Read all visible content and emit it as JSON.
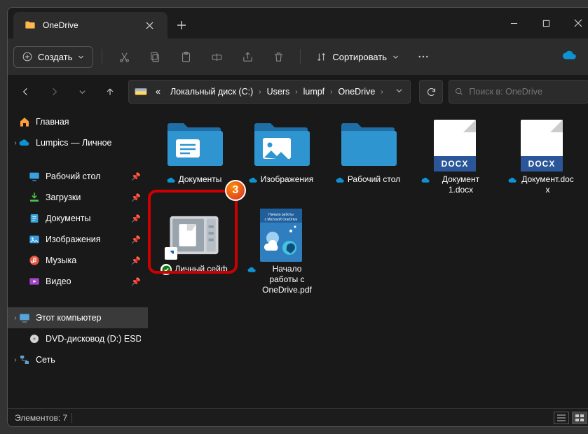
{
  "tab": {
    "title": "OneDrive"
  },
  "toolbar": {
    "new_label": "Создать",
    "sort_label": "Сортировать"
  },
  "breadcrumb": {
    "disk_prefix": "«",
    "segments": [
      "Локальный диск (C:)",
      "Users",
      "lumpf",
      "OneDrive"
    ]
  },
  "search": {
    "placeholder": "Поиск в: OneDrive"
  },
  "sidebar": {
    "home": "Главная",
    "onedrive": "Lumpics — Личное",
    "desktop": "Рабочий стол",
    "downloads": "Загрузки",
    "documents": "Документы",
    "pictures": "Изображения",
    "music": "Музыка",
    "videos": "Видео",
    "this_pc": "Этот компьютер",
    "dvd": "DVD-дисковод (D:) ESD-IS",
    "network": "Сеть"
  },
  "items": [
    {
      "label": "Документы",
      "type": "folder-docs"
    },
    {
      "label": "Изображения",
      "type": "folder-pics"
    },
    {
      "label": "Рабочий стол",
      "type": "folder-plain"
    },
    {
      "label": "Документ 1.docx",
      "type": "docx"
    },
    {
      "label": "Документ.docx",
      "type": "docx"
    },
    {
      "label": "Личный сейф",
      "type": "safe"
    },
    {
      "label": "Начало работы с OneDrive.pdf",
      "type": "pdf"
    }
  ],
  "highlight": {
    "number": "3"
  },
  "status": {
    "text": "Элементов: 7"
  }
}
